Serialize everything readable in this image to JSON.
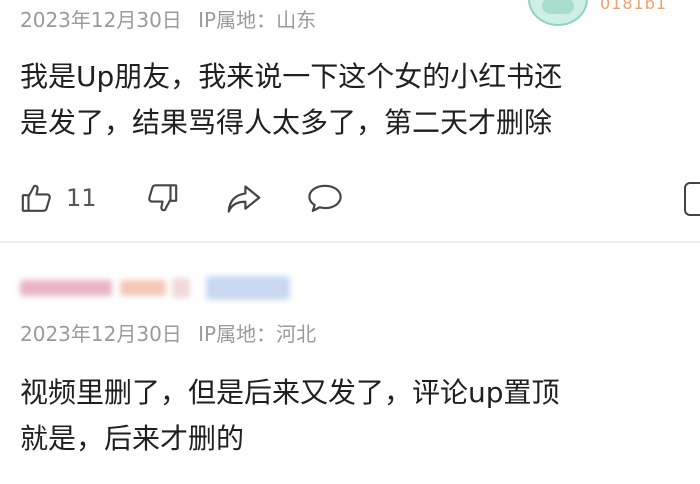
{
  "comments": [
    {
      "date": "2023年12月30日",
      "ip_location": "IP属地：山东",
      "text_line1": "我是Up朋友，我来说一下这个女的小红书还",
      "text_line2": "是发了，结果骂得人太多了，第二天才删除",
      "likes": "11",
      "avatar_badge": "0181b1"
    },
    {
      "date": "2023年12月30日",
      "ip_location": "IP属地：河北",
      "text_line1": "视频里删了，但是后来又发了，评论up置顶",
      "text_line2": "就是，后来才删的"
    }
  ],
  "colors": {
    "meta_text": "#9a9a9a",
    "icon_stroke": "#444444",
    "divider": "#eeeeee",
    "avatar_teal": "#8fd3c7",
    "badge_orange": "#f0a070"
  },
  "icons": [
    "thumbs-up-icon",
    "thumbs-down-icon",
    "share-icon",
    "comment-icon"
  ]
}
